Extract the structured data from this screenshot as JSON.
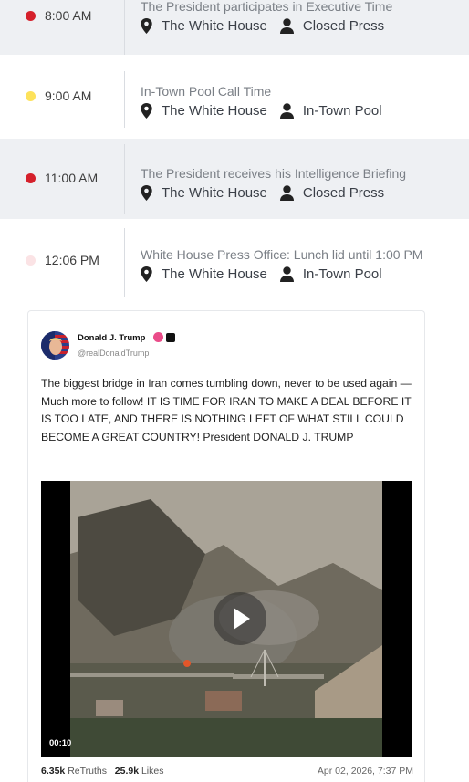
{
  "schedule": [
    {
      "time": "8:00 AM",
      "color": "#d5202b",
      "title": "The President participates in Executive Time",
      "location": "The White House",
      "coverage": "Closed Press"
    },
    {
      "time": "9:00 AM",
      "color": "#fde25b",
      "title": "In-Town Pool Call Time",
      "location": "The White House",
      "coverage": "In-Town Pool"
    },
    {
      "time": "11:00 AM",
      "color": "#d5202b",
      "title": "The President receives his Intelligence Briefing",
      "location": "The White House",
      "coverage": "Closed Press"
    },
    {
      "time": "12:06 PM",
      "color": "#fbe3e5",
      "title": "White House Press Office: Lunch lid until 1:00 PM",
      "location": "The White House",
      "coverage": "In-Town Pool"
    }
  ],
  "post": {
    "name": "Donald J. Trump",
    "handle": "@realDonaldTrump",
    "text": "The biggest bridge in Iran comes tumbling down, never to be used again — Much more to follow! IT IS TIME FOR IRAN TO MAKE A DEAL BEFORE IT IS TOO LATE, AND THERE IS NOTHING LEFT OF WHAT STILL COULD BECOME A GREAT COUNTRY! President DONALD J. TRUMP",
    "video_time": "00:10",
    "retruths_count": "6.35k",
    "retruths_label": "ReTruths",
    "likes_count": "25.9k",
    "likes_label": "Likes",
    "date": "Apr 02, 2026, 7:37 PM"
  },
  "icons": {
    "location": "location-pin-icon",
    "person": "person-icon",
    "verified": "verified-badge-icon",
    "play": "play-icon"
  }
}
